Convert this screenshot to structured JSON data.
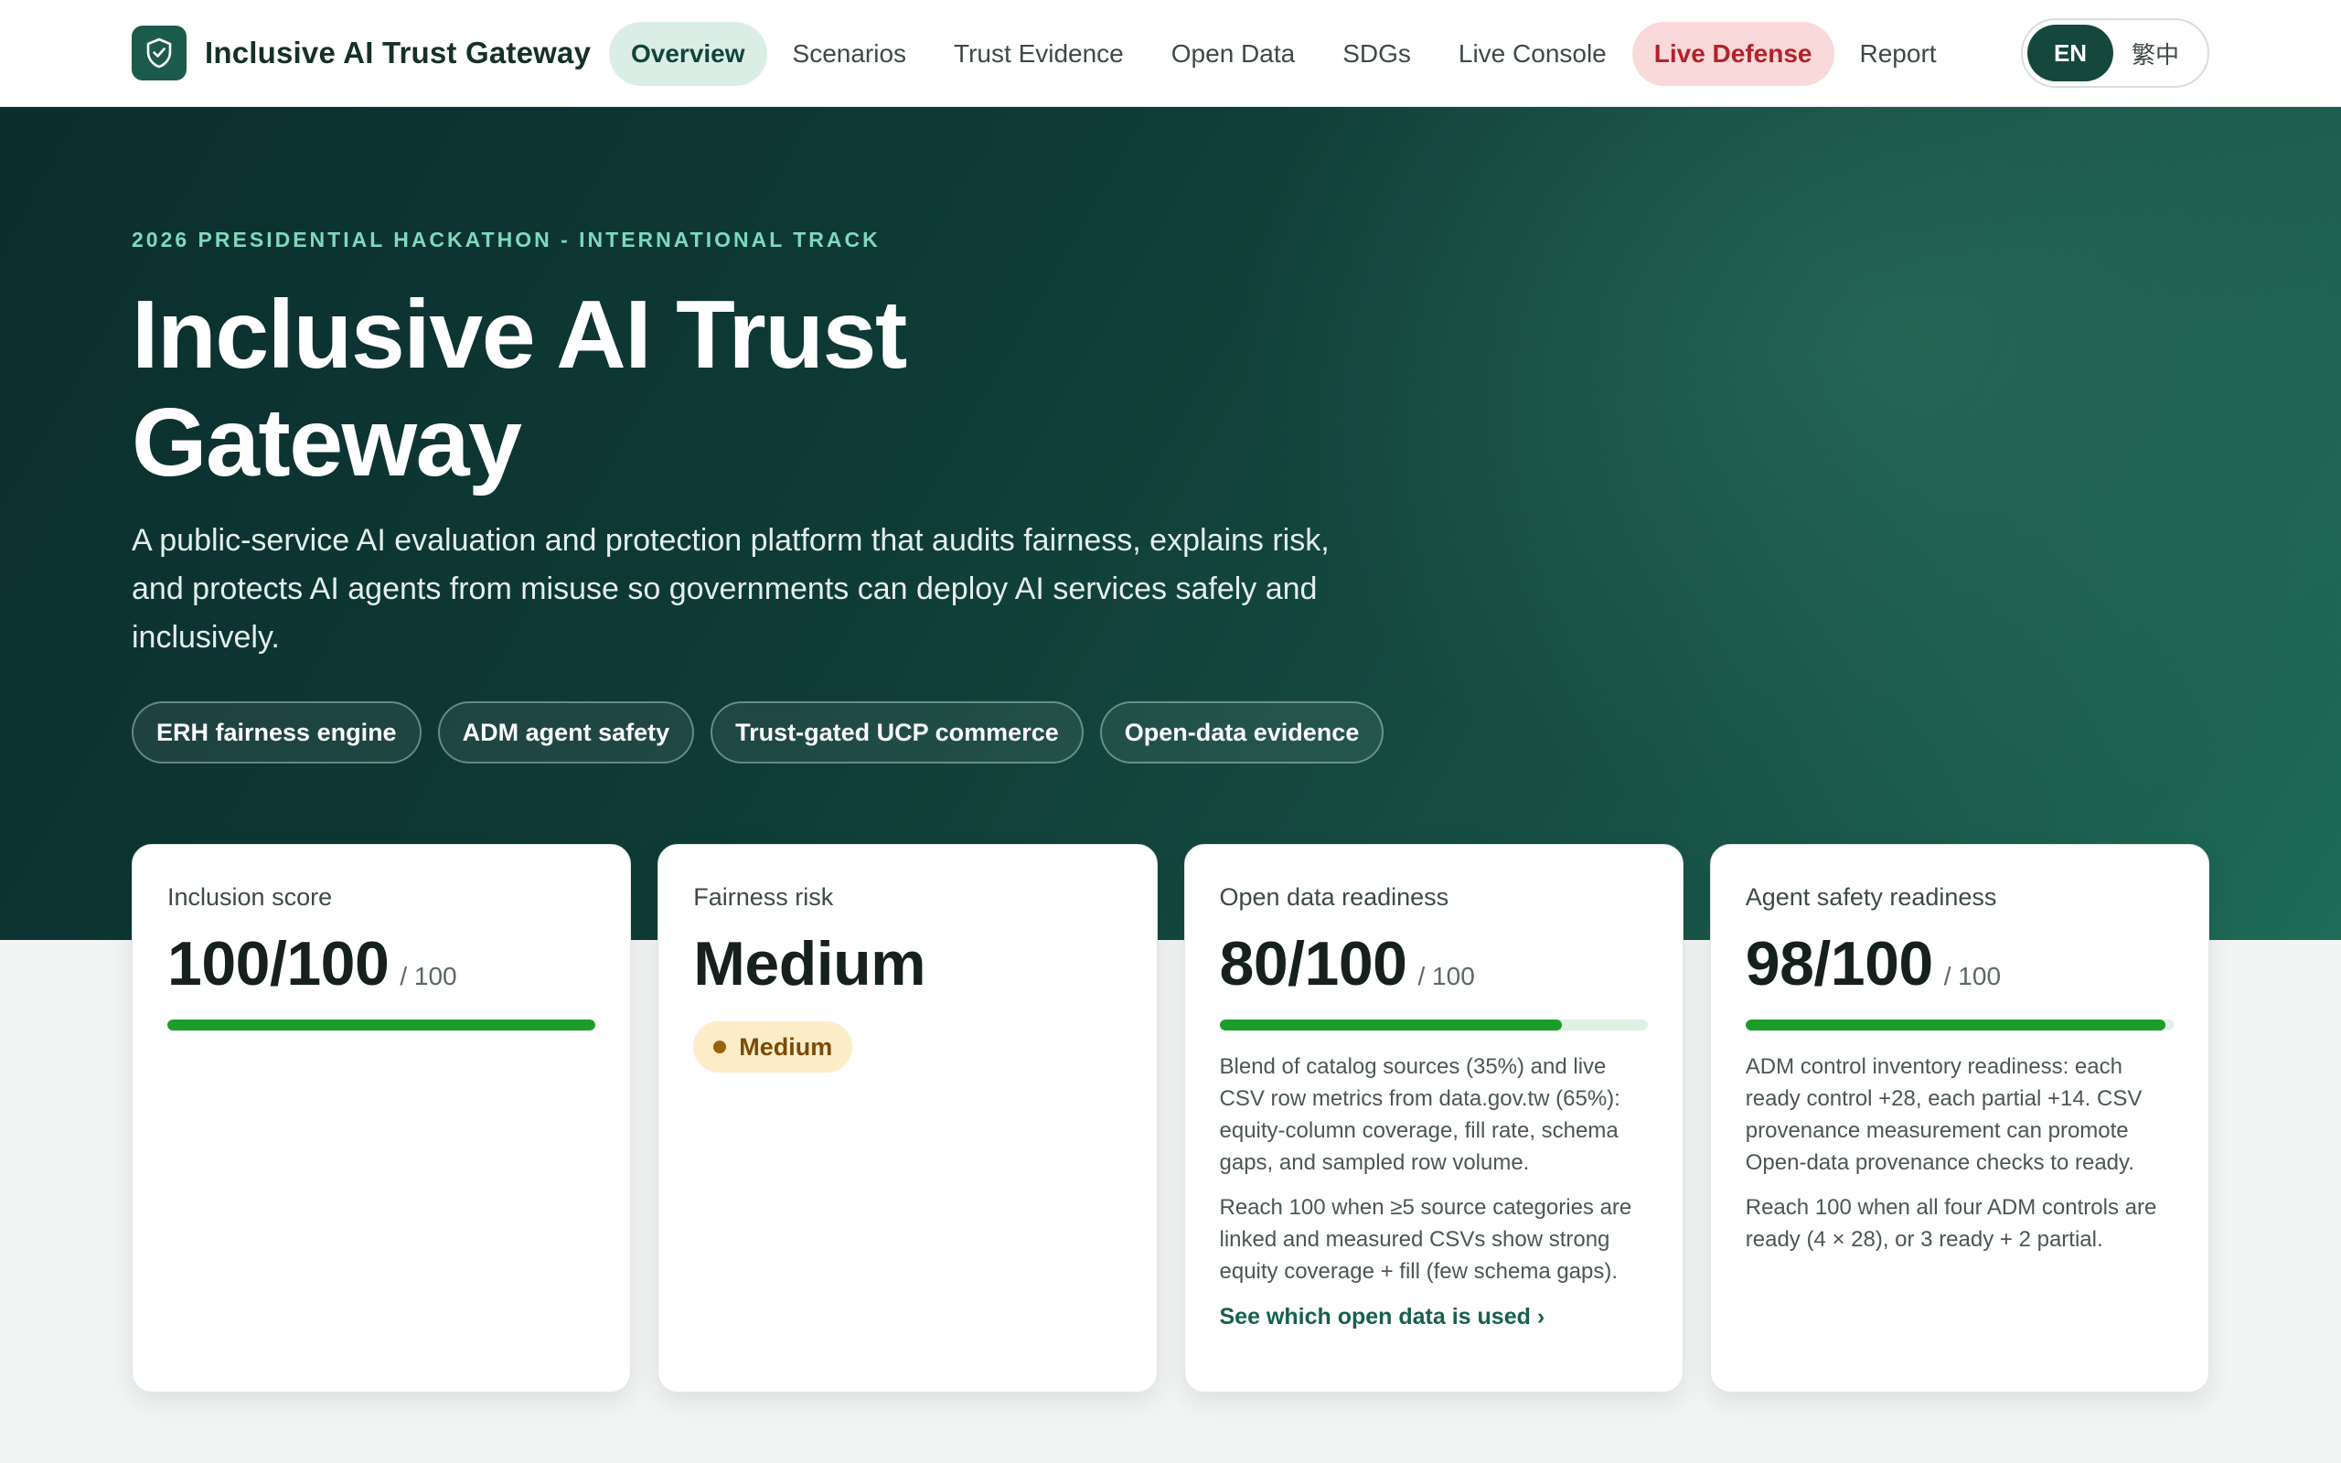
{
  "brand": {
    "name": "Inclusive AI Trust Gateway",
    "logo_icon": "shield-check-icon"
  },
  "nav": {
    "items": [
      {
        "label": "Overview",
        "state": "active"
      },
      {
        "label": "Scenarios",
        "state": "normal"
      },
      {
        "label": "Trust Evidence",
        "state": "normal"
      },
      {
        "label": "Open Data",
        "state": "normal"
      },
      {
        "label": "SDGs",
        "state": "normal"
      },
      {
        "label": "Live Console",
        "state": "normal"
      },
      {
        "label": "Live Defense",
        "state": "danger"
      },
      {
        "label": "Report",
        "state": "normal"
      }
    ],
    "language": {
      "selected": "EN",
      "other": "繁中"
    }
  },
  "hero": {
    "eyebrow": "2026 PRESIDENTIAL HACKATHON - INTERNATIONAL TRACK",
    "title": "Inclusive AI Trust Gateway",
    "description": "A public-service AI evaluation and protection platform that audits fairness, explains risk, and protects AI agents from misuse so governments can deploy AI services safely and inclusively.",
    "chips": [
      "ERH fairness engine",
      "ADM agent safety",
      "Trust-gated UCP commerce",
      "Open-data evidence"
    ]
  },
  "cards": [
    {
      "label": "Inclusion score",
      "value": "100/100",
      "suffix": "/ 100",
      "progress": 1.0
    },
    {
      "label": "Fairness risk",
      "value": "Medium",
      "badge": "Medium"
    },
    {
      "label": "Open data readiness",
      "value": "80/100",
      "suffix": "/ 100",
      "progress": 0.8,
      "notes": [
        "Blend of catalog sources (35%) and live CSV row metrics from data.gov.tw (65%): equity-column coverage, fill rate, schema gaps, and sampled row volume.",
        "Reach 100 when ≥5 source categories are linked and measured CSVs show strong equity coverage + fill (few schema gaps)."
      ],
      "link": "See which open data is used ›"
    },
    {
      "label": "Agent safety readiness",
      "value": "98/100",
      "suffix": "/ 100",
      "progress": 0.98,
      "notes": [
        "ADM control inventory readiness: each ready control +28, each partial +14. CSV provenance measurement can promote Open-data provenance checks to ready.",
        "Reach 100 when all four ADM controls are ready (4 × 28), or 3 ready + 2 partial."
      ]
    }
  ],
  "colors": {
    "accent": "#1c5b4c",
    "progress": "#1d9c2a",
    "danger": "#b3222a",
    "warning_badge": "#fcecc8"
  }
}
